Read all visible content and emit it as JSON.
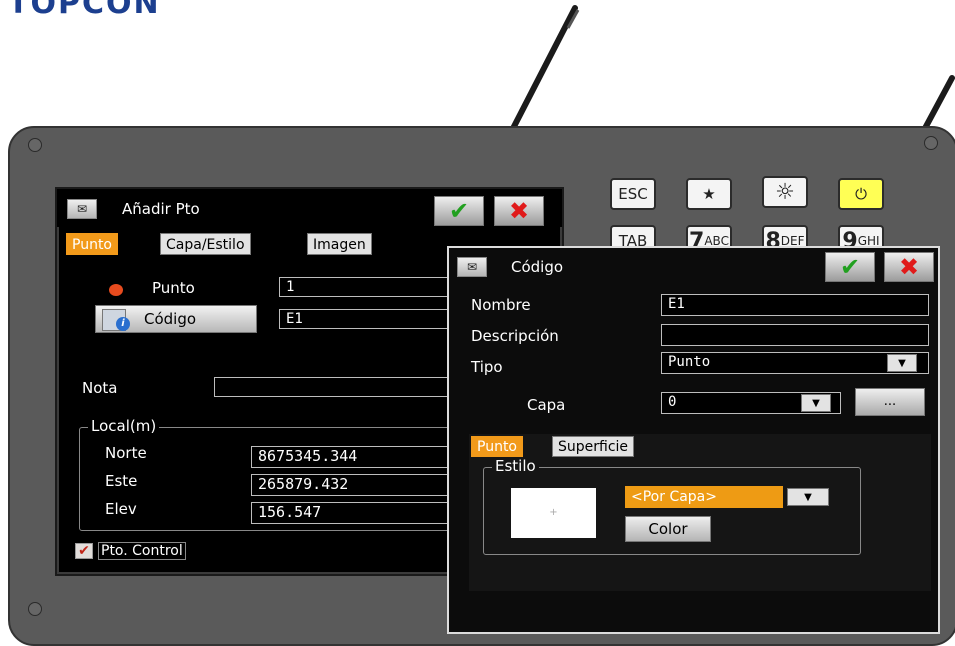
{
  "brand": {
    "logo_text": "TOPCON"
  },
  "keypad": [
    {
      "name": "esc-key",
      "label": "ESC",
      "big": "",
      "small": ""
    },
    {
      "name": "star-key",
      "label": "★",
      "big": "",
      "small": ""
    },
    {
      "name": "brightness-key",
      "label": "☼",
      "big": "",
      "small": ""
    },
    {
      "name": "power-key",
      "label": "⏻",
      "big": "",
      "small": ""
    },
    {
      "name": "tab-key",
      "label": "TAB",
      "big": "",
      "small": ""
    },
    {
      "name": "seven-abc-key",
      "label": "",
      "big": "7",
      "small": "ABC"
    },
    {
      "name": "eight-def-key",
      "label": "",
      "big": "8",
      "small": "DEF"
    },
    {
      "name": "nine-ghi-key",
      "label": "",
      "big": "9",
      "small": "GHI"
    }
  ],
  "main_window": {
    "title": "Añadir Pto",
    "tabs": [
      "Punto",
      "Capa/Estilo",
      "Imagen"
    ],
    "punto_label": "Punto",
    "punto_value": "1",
    "codigo_button": "Código",
    "codigo_value": "E1",
    "nota_label": "Nota",
    "nota_value": "",
    "local_group": "Local(m)",
    "norte_label": "Norte",
    "norte_value": "8675345.344",
    "este_label": "Este",
    "este_value": "265879.432",
    "elev_label": "Elev",
    "elev_value": "156.547",
    "control_checked": true,
    "control_label": "Pto. Control"
  },
  "codigo_dialog": {
    "title": "Código",
    "nombre_label": "Nombre",
    "nombre_value": "E1",
    "descripcion_label": "Descripción",
    "descripcion_value": "",
    "tipo_label": "Tipo",
    "tipo_value": "Punto",
    "capa_label": "Capa",
    "capa_value": "0",
    "more_button": "...",
    "tabs": [
      "Punto",
      "Superficie"
    ],
    "estilo_group": "Estilo",
    "preview_symbol": "+",
    "style_value": "<Por Capa>",
    "color_button": "Color"
  },
  "colors": {
    "accent_orange": "#f29a1a",
    "ok_green": "#22a020",
    "cancel_red": "#e01a1a",
    "screen_bg": "#000000",
    "device_gray": "#5a5a5a"
  }
}
